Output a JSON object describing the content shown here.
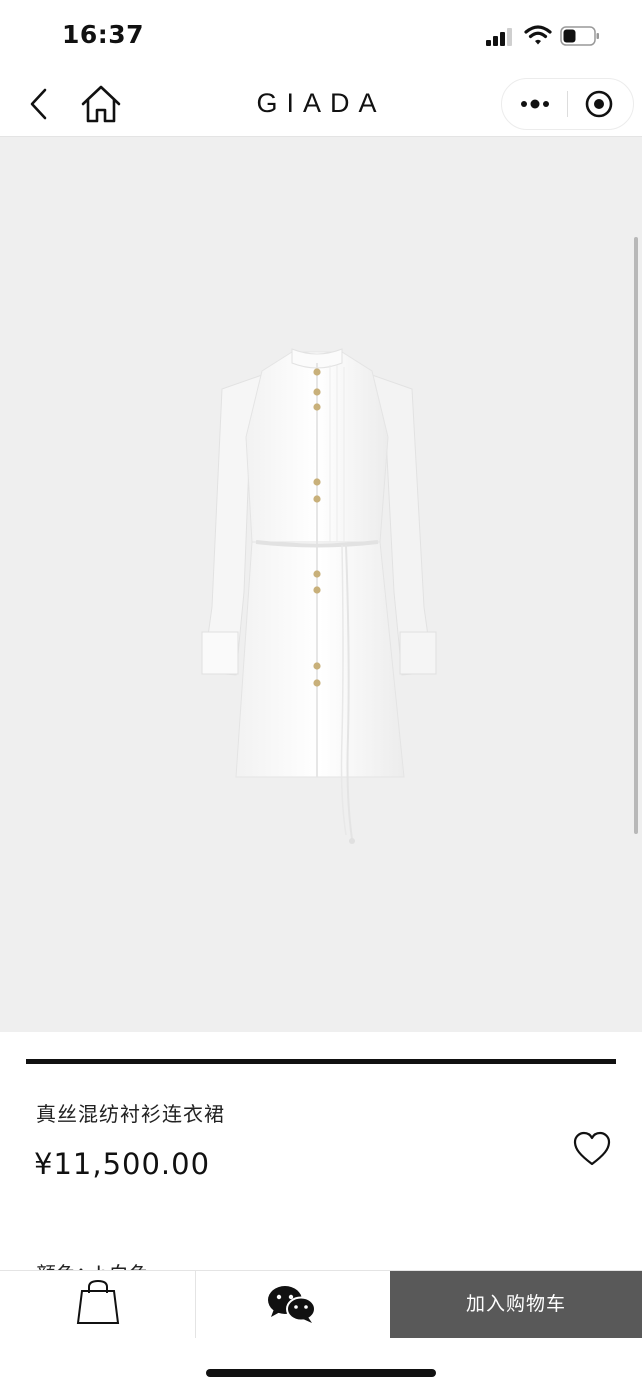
{
  "status_bar": {
    "time": "16:37"
  },
  "nav": {
    "brand": "GIADA"
  },
  "product": {
    "name": "真丝混纺衬衫连衣裙",
    "price": "¥11,500.00",
    "image_description": "white silk shirt dress with belt",
    "partial_next_line": "颜色：b白色"
  },
  "actions": {
    "add_to_cart_label": "加入购物车"
  },
  "icons": {
    "back": "chevron-left-icon",
    "home": "home-icon",
    "more": "more-dots-icon",
    "close": "target-close-icon",
    "favorite": "heart-icon",
    "bag": "shopping-bag-icon",
    "chat": "wechat-icon"
  },
  "colors": {
    "image_background": "#efefef",
    "cart_button": "#595959",
    "accent": "#111111"
  }
}
